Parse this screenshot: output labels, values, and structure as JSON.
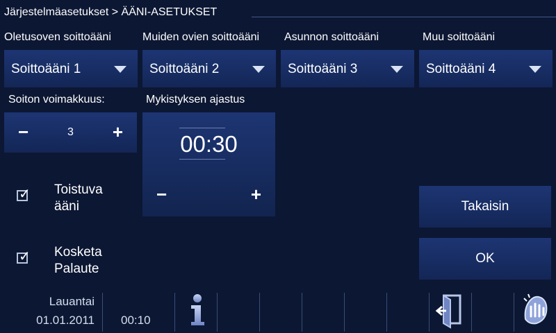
{
  "breadcrumb": "Järjestelmäasetukset > ÄÄNI-ASETUKSET",
  "ringtones": [
    {
      "label": "Oletusoven soittoääni",
      "value": "Soittoääni 1"
    },
    {
      "label": "Muiden ovien soittoääni",
      "value": "Soittoääni 2"
    },
    {
      "label": "Asunnon soittoääni",
      "value": "Soittoääni 3"
    },
    {
      "label": "Muu soittoääni",
      "value": "Soittoääni 4"
    }
  ],
  "volume": {
    "label": "Soiton voimakkuus:",
    "value": "3",
    "minus": "−",
    "plus": "+"
  },
  "mute": {
    "label": "Mykistyksen ajastus",
    "time": "00:30",
    "minus": "−",
    "plus": "+"
  },
  "checkboxes": [
    {
      "label": "Toistuva ääni",
      "checked": true
    },
    {
      "label": "Kosketa Palaute",
      "checked": true
    }
  ],
  "buttons": {
    "back": "Takaisin",
    "ok": "OK"
  },
  "statusbar": {
    "day": "Lauantai",
    "date": "01.01.2011",
    "time": "00:10",
    "icons": [
      "info-icon",
      "exit-door-icon",
      "cleaning-hand-icon"
    ]
  },
  "colors": {
    "background": "#0c1733",
    "panel": "#1d3573",
    "accent": "#7b8fc8"
  }
}
